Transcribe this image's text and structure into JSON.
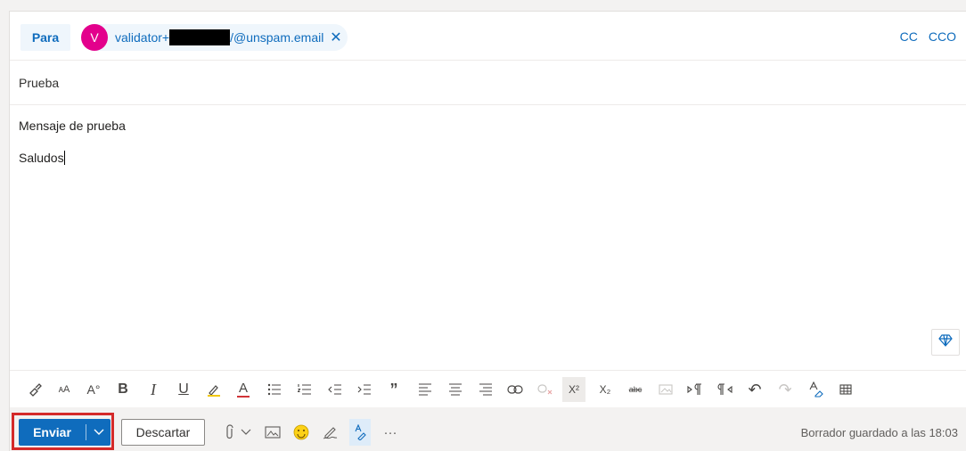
{
  "recipients": {
    "to_label": "Para",
    "avatar_initial": "V",
    "email_prefix": "validator+",
    "email_suffix": "/@unspam.email",
    "remove_glyph": "✕",
    "cc_label": "CC",
    "bcc_label": "CCO"
  },
  "subject": "Prueba",
  "body": {
    "line1": "Mensaje de prueba",
    "line2": "Saludos"
  },
  "actions": {
    "send_label": "Enviar",
    "discard_label": "Descartar",
    "draft_status": "Borrador guardado a las 18:03"
  },
  "format_toolbar": {
    "bold": "B",
    "italic": "I",
    "underline": "U",
    "font_color": "A",
    "font_size_small": "ᴀA",
    "font_size_grow": "A°",
    "quote": "”",
    "superscript": "X²",
    "subscript": "X₂",
    "strike": "abc",
    "undo": "↶",
    "redo": "↷",
    "more": "···"
  },
  "colors": {
    "accent": "#0f6cbd",
    "avatar": "#e3008c",
    "highlight_outline": "#d42a2a"
  },
  "icons": [
    "format-painter-icon",
    "font-size-decrease-icon",
    "font-size-increase-icon",
    "bold-icon",
    "italic-icon",
    "underline-icon",
    "highlight-icon",
    "font-color-icon",
    "bullets-icon",
    "numbering-icon",
    "decrease-indent-icon",
    "increase-indent-icon",
    "quote-icon",
    "align-left-icon",
    "align-center-icon",
    "align-right-icon",
    "link-icon",
    "unlink-icon",
    "superscript-icon",
    "subscript-icon",
    "strikethrough-icon",
    "picture-placeholder-icon",
    "ltr-icon",
    "rtl-icon",
    "undo-icon",
    "redo-icon",
    "clear-format-icon",
    "table-icon",
    "attach-icon",
    "image-icon",
    "emoji-icon",
    "signature-icon",
    "editor-icon",
    "more-icon",
    "premium-diamond-icon"
  ]
}
